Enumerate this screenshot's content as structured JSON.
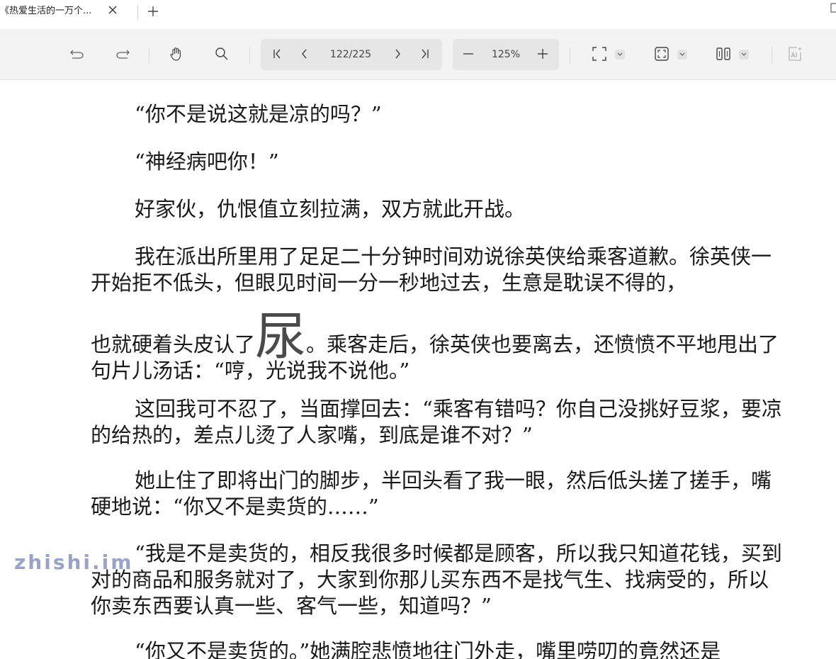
{
  "tab": {
    "title": "《热爱生活的一万个..."
  },
  "toolbar": {
    "page_indicator": "122/225",
    "zoom_level": "125%"
  },
  "document": {
    "paragraphs": [
      "“你不是说这就是凉的吗？”",
      "“神经病吧你！”",
      "好家伙，仇恨值立刻拉满，双方就此开战。",
      "我在派出所里用了足足二十分钟时间劝说徐英侠给乘客道歉。徐英侠一开始拒不低头，但眼见时间一分一秒地过去，生意是耽误不得的，",
      "也就硬着头皮认了",
      "。乘客走后，徐英侠也要离去，还愤愤不平地甩出了句片儿汤话：“哼，光说我不说他。”",
      "这回我可不忍了，当面撑回去：“乘客有错吗？你自己没挑好豆浆，要凉的给热的，差点儿烫了人家嘴，到底是谁不对？”",
      "她止住了即将出门的脚步，半回头看了我一眼，然后低头搓了搓手，嘴硬地说：“你又不是卖货的……”",
      "“我是不是卖货的，相反我很多时候都是顾客，所以我只知道花钱，买到对的商品和服务就对了，大家到你那儿买东西不是找气生、找病受的，所以你卖东西要认真一些、客气一些，知道吗？”",
      "“你又不是卖货的。”她满腔悲愤地往门外走，嘴里唠叨的竟然还是"
    ],
    "inline_image_char": "尿"
  },
  "watermark": {
    "text": "zhishi.im"
  }
}
